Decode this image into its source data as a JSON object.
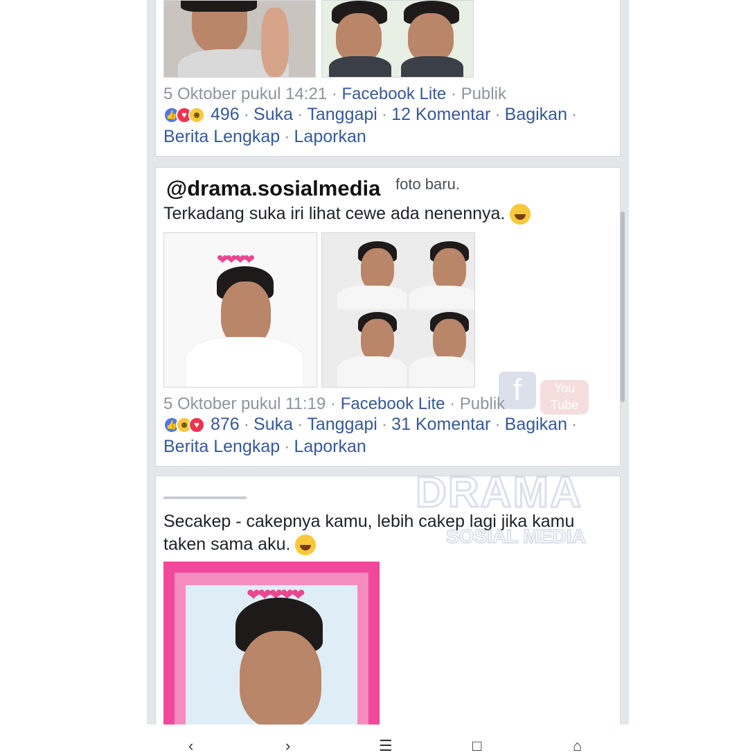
{
  "posts": [
    {
      "timestamp": "5 Oktober pukul 14:21",
      "app": "Facebook Lite",
      "privacy": "Publik",
      "reaction_count": "496",
      "reactions": [
        "like",
        "love",
        "haha"
      ],
      "actions": [
        "Suka",
        "Tanggapi",
        "12 Komentar",
        "Bagikan"
      ],
      "more": [
        "Berita Lengkap",
        "Laporkan"
      ]
    },
    {
      "header_visible": "foto baru.",
      "text": "Terkadang suka iri lihat cewe ada nenennya.",
      "timestamp": "5 Oktober pukul 11:19",
      "app": "Facebook Lite",
      "privacy": "Publik",
      "reaction_count": "876",
      "reactions": [
        "like",
        "haha",
        "love"
      ],
      "actions": [
        "Suka",
        "Tanggapi",
        "31 Komentar",
        "Bagikan"
      ],
      "more": [
        "Berita Lengkap",
        "Laporkan"
      ]
    },
    {
      "text_line1": "Secakep - cakepnya kamu, lebih cakep lagi jika kamu",
      "text_line2": "taken sama aku."
    }
  ],
  "watermark": {
    "handle": "@drama.sosialmedia",
    "logo_main": "DRAMA",
    "logo_sub": "SOSIAL MEDIA",
    "logo_youtube": "You Tube"
  },
  "colors": {
    "link": "#365899",
    "meta": "#8d949e",
    "like": "#4a78e8",
    "love": "#f0334f",
    "haha": "#f7c83a",
    "pink_frame": "#f0489a"
  }
}
